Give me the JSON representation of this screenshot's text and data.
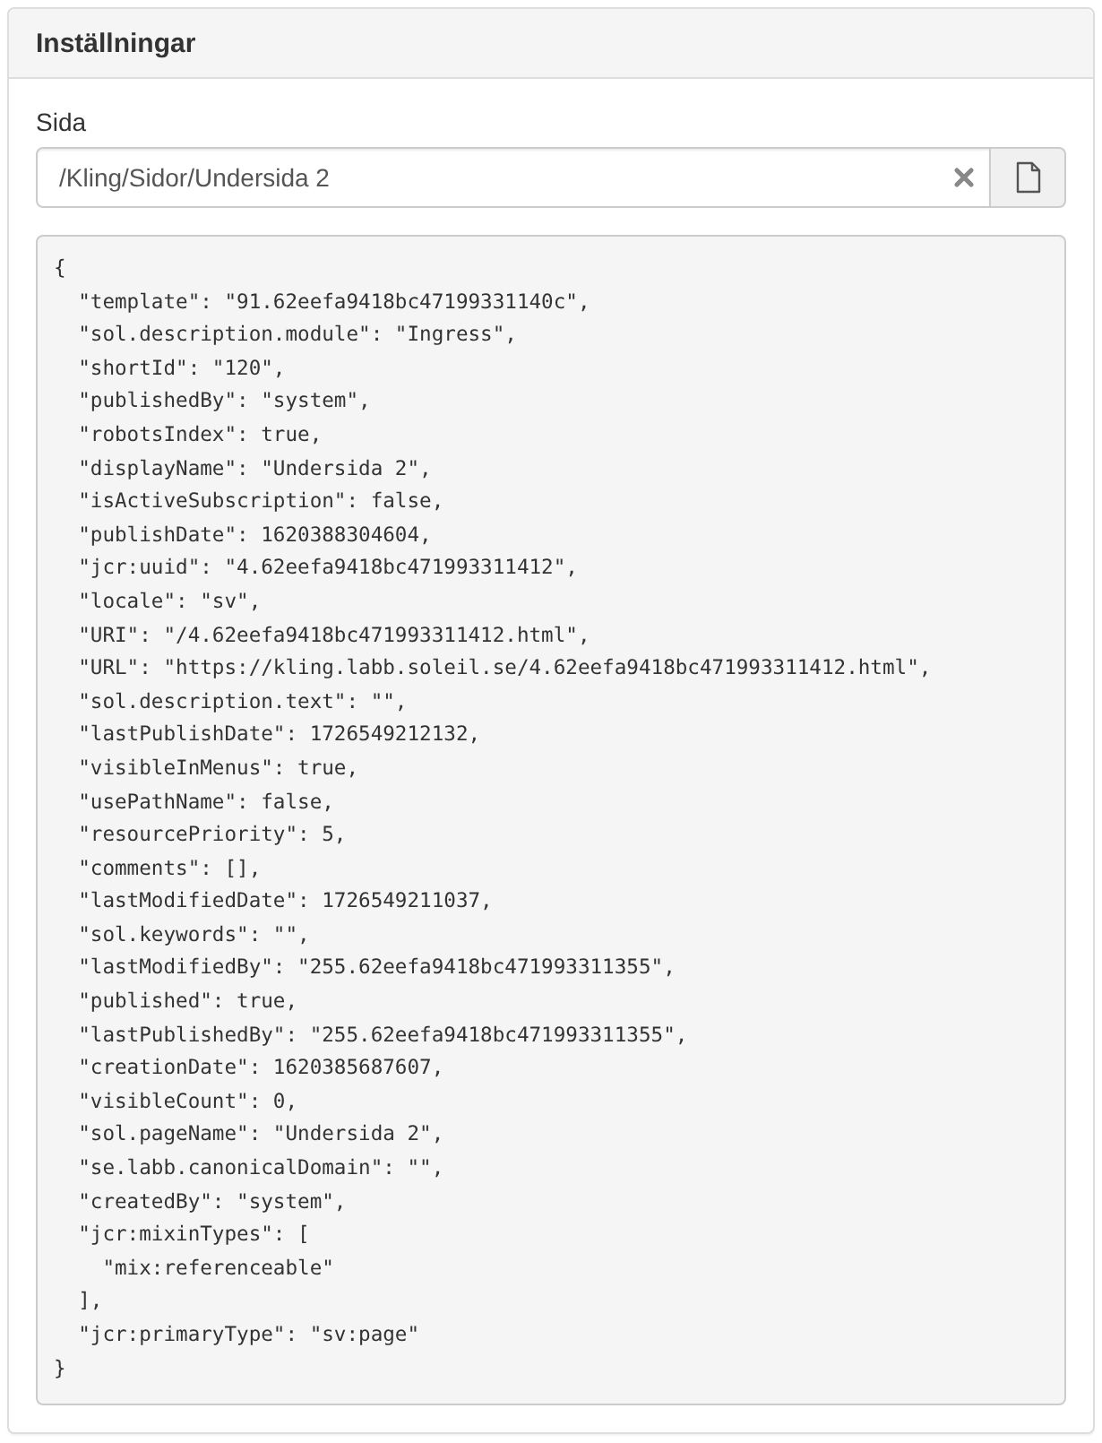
{
  "panel": {
    "title": "Inställningar"
  },
  "field": {
    "label": "Sida",
    "value": "/Kling/Sidor/Undersida 2"
  },
  "code_lines": [
    "{",
    "  \"template\": \"91.62eefa9418bc47199331140c\",",
    "  \"sol.description.module\": \"Ingress\",",
    "  \"shortId\": \"120\",",
    "  \"publishedBy\": \"system\",",
    "  \"robotsIndex\": true,",
    "  \"displayName\": \"Undersida 2\",",
    "  \"isActiveSubscription\": false,",
    "  \"publishDate\": 1620388304604,",
    "  \"jcr:uuid\": \"4.62eefa9418bc471993311412\",",
    "  \"locale\": \"sv\",",
    "  \"URI\": \"/4.62eefa9418bc471993311412.html\",",
    "  \"URL\": \"https://kling.labb.soleil.se/4.62eefa9418bc471993311412.html\",",
    "  \"sol.description.text\": \"\",",
    "  \"lastPublishDate\": 1726549212132,",
    "  \"visibleInMenus\": true,",
    "  \"usePathName\": false,",
    "  \"resourcePriority\": 5,",
    "  \"comments\": [],",
    "  \"lastModifiedDate\": 1726549211037,",
    "  \"sol.keywords\": \"\",",
    "  \"lastModifiedBy\": \"255.62eefa9418bc471993311355\",",
    "  \"published\": true,",
    "  \"lastPublishedBy\": \"255.62eefa9418bc471993311355\",",
    "  \"creationDate\": 1620385687607,",
    "  \"visibleCount\": 0,",
    "  \"sol.pageName\": \"Undersida 2\",",
    "  \"se.labb.canonicalDomain\": \"\",",
    "  \"createdBy\": \"system\",",
    "  \"jcr:mixinTypes\": [",
    "    \"mix:referenceable\"",
    "  ],",
    "  \"jcr:primaryType\": \"sv:page\"",
    "}"
  ]
}
